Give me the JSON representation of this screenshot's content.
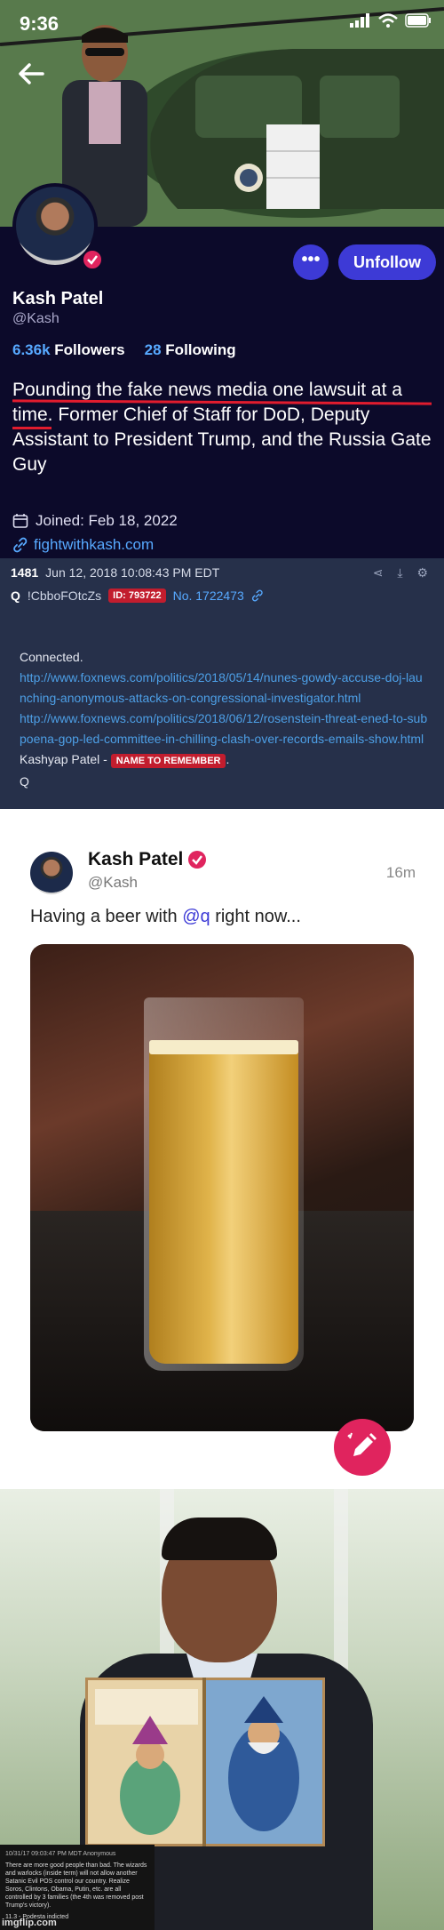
{
  "status_bar": {
    "time": "9:36"
  },
  "profile": {
    "name": "Kash Patel",
    "handle": "@Kash",
    "followers_count": "6.36k",
    "followers_label": "Followers",
    "following_count": "28",
    "following_label": "Following",
    "bio": "Pounding the fake news media one lawsuit at a time. Former Chief of Staff for DoD, Deputy Assistant to President Trump, and the Russia Gate Guy",
    "joined": "Joined: Feb 18, 2022",
    "website": "fightwithkash.com",
    "more_label": "•••",
    "unfollow_label": "Unfollow"
  },
  "q_post": {
    "post_number": "1481",
    "date": "Jun 12, 2018 10:08:43 PM EDT",
    "q_trip": "Q",
    "q_id": "!CbboFOtcZs",
    "id_badge": "ID: 793722",
    "post_no": "No. 1722473",
    "connected": "Connected.",
    "link1": "http://www.foxnews.com/politics/2018/05/14/nunes-gowdy-accuse-doj-launching-anonymous-attacks-on-congressional-investigator.html",
    "link2": "http://www.foxnews.com/politics/2018/06/12/rosenstein-threat-ened-to-subpoena-gop-led-committee-in-chilling-clash-over-records-emails-show.html",
    "kp_line": "Kashyap Patel -",
    "name_badge": "NAME TO REMEMBER",
    "sign": "Q"
  },
  "tweet": {
    "name": "Kash Patel",
    "handle": "@Kash",
    "time": "16m",
    "text_prefix": "Having a beer with ",
    "mention": "@q",
    "text_suffix": " right now..."
  },
  "meme_caption": {
    "header": "10/31/17 09:03:47 PM MDT Anonymous",
    "text": "There are more good people than bad. The wizards and warlocks (inside term) will not allow another Satanic Evil POS control our country. Realize Soros, Clintons, Obama, Putin, etc. are all controlled by 3 families (the 4th was removed post Trump's victory).",
    "footer": "11.3 - Podesta indicted",
    "watermark": "imgflip.com"
  }
}
